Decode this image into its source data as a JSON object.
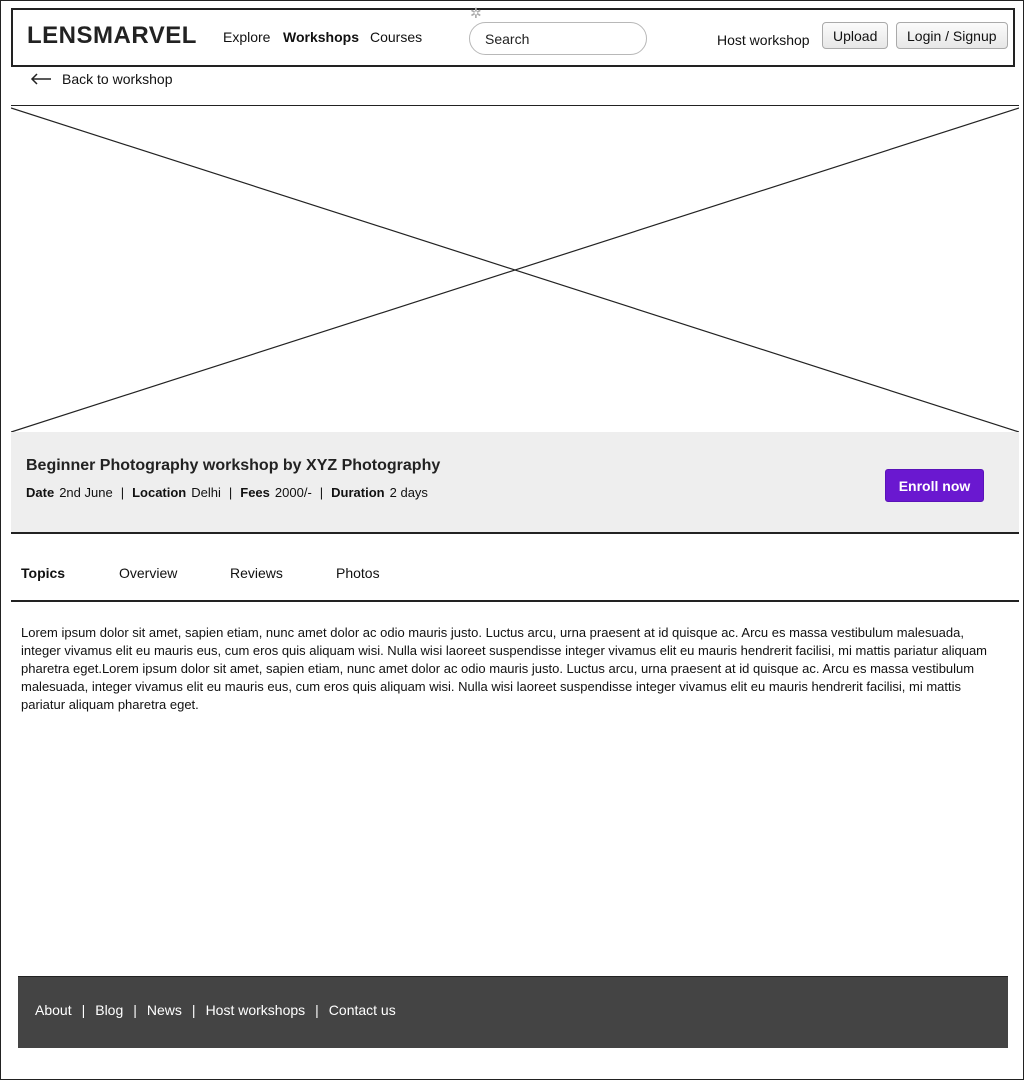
{
  "header": {
    "logo": "LENSMARVEL",
    "nav": [
      "Explore",
      "Workshops",
      "Courses"
    ],
    "active_nav": "Workshops",
    "search_placeholder": "Search",
    "host_link": "Host workshop",
    "upload_label": "Upload",
    "login_label": "Login / Signup"
  },
  "back_link": "Back to workshop",
  "workshop": {
    "title": "Beginner Photography workshop by XYZ Photography",
    "date_label": "Date",
    "date": "2nd June",
    "location_label": "Location",
    "location": "Delhi",
    "fees_label": "Fees",
    "fees": "2000/-",
    "duration_label": "Duration",
    "duration": "2 days",
    "separator": "|",
    "enroll_label": "Enroll now"
  },
  "tabs": [
    "Topics",
    "Overview",
    "Reviews",
    "Photos"
  ],
  "active_tab": "Topics",
  "content_text": "Lorem ipsum dolor sit amet, sapien etiam, nunc amet dolor ac odio mauris justo. Luctus arcu, urna praesent at id quisque ac. Arcu es massa vestibulum malesuada, integer vivamus elit eu mauris eus, cum eros quis aliquam wisi. Nulla wisi laoreet suspendisse integer vivamus elit eu mauris hendrerit facilisi, mi mattis pariatur aliquam pharetra eget.Lorem ipsum dolor sit amet, sapien etiam, nunc amet dolor ac odio mauris justo. Luctus arcu, urna praesent at id quisque ac. Arcu es massa vestibulum malesuada, integer vivamus elit eu mauris eus, cum eros quis aliquam wisi. Nulla wisi laoreet suspendisse integer vivamus elit eu mauris hendrerit facilisi, mi mattis pariatur aliquam pharetra eget.",
  "footer": {
    "links": [
      "About",
      "Blog",
      "News",
      "Host workshops",
      "Contact us"
    ],
    "separator": "|"
  },
  "colors": {
    "enroll_button": "#6a18d0",
    "info_band": "#eeeeee",
    "footer_bg": "#444444"
  }
}
